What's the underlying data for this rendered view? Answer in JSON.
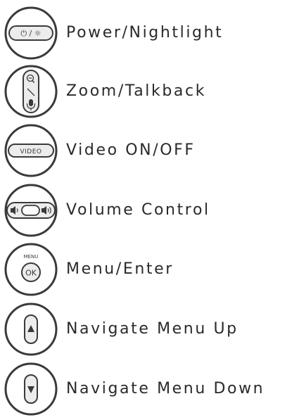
{
  "legend": {
    "items": [
      {
        "icon": "power-nightlight-button-icon",
        "label": "Power/Nightlight",
        "icon_text": "⏻ / ☼"
      },
      {
        "icon": "zoom-talkback-button-icon",
        "label": "Zoom/Talkback"
      },
      {
        "icon": "video-button-icon",
        "label": "Video ON/OFF",
        "icon_text": "VIDEO"
      },
      {
        "icon": "volume-control-button-icon",
        "label": "Volume Control"
      },
      {
        "icon": "menu-ok-button-icon",
        "label": "Menu/Enter",
        "icon_text_top": "MENU",
        "icon_text_center": "OK"
      },
      {
        "icon": "navigate-up-button-icon",
        "label": "Navigate Menu Up"
      },
      {
        "icon": "navigate-down-button-icon",
        "label": "Navigate Menu Down"
      }
    ]
  }
}
